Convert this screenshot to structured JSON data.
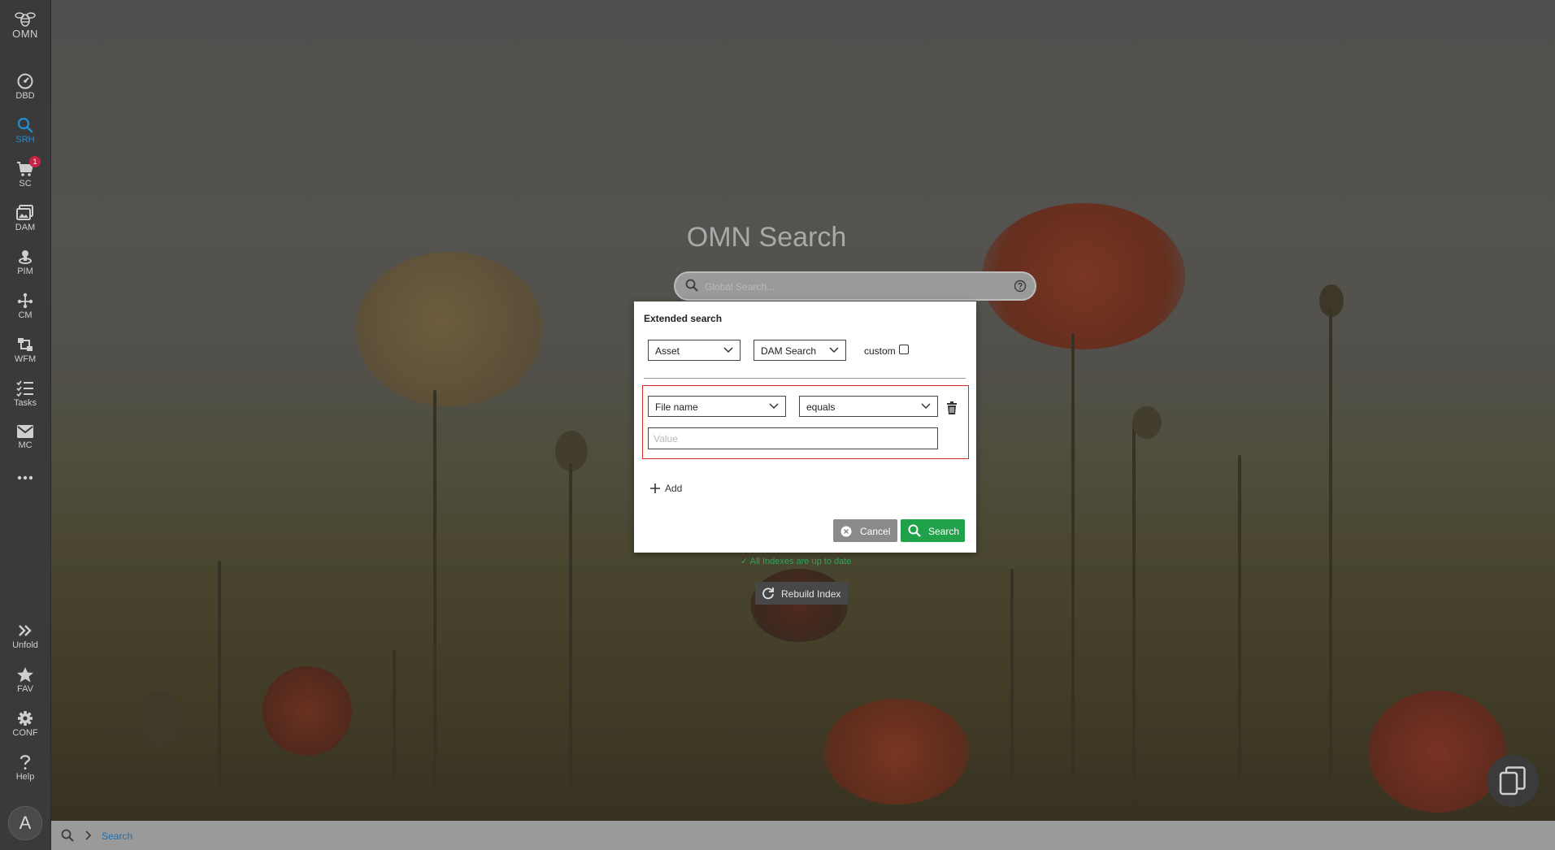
{
  "sidebar": {
    "logo_text": "OMN",
    "items": [
      {
        "label": "DBD",
        "icon": "dashboard-icon"
      },
      {
        "label": "SRH",
        "icon": "search-icon",
        "active": true
      },
      {
        "label": "SC",
        "icon": "cart-icon",
        "badge": "1"
      },
      {
        "label": "DAM",
        "icon": "images-icon"
      },
      {
        "label": "PIM",
        "icon": "product-icon"
      },
      {
        "label": "CM",
        "icon": "hierarchy-icon"
      },
      {
        "label": "WFM",
        "icon": "workflow-icon"
      },
      {
        "label": "Tasks",
        "icon": "tasks-icon"
      },
      {
        "label": "MC",
        "icon": "mail-icon"
      },
      {
        "label": "",
        "icon": "more-icon"
      }
    ],
    "bottom_items": [
      {
        "label": "Unfold",
        "icon": "double-chevron-icon"
      },
      {
        "label": "FAV",
        "icon": "star-icon"
      },
      {
        "label": "CONF",
        "icon": "gear-icon"
      },
      {
        "label": "Help",
        "icon": "question-icon"
      }
    ],
    "avatar_initial": "A"
  },
  "main": {
    "title": "OMN Search",
    "search_placeholder": "Global Search..."
  },
  "dialog": {
    "header": "Extended search",
    "type_select": "Asset",
    "search_select": "DAM Search",
    "custom_label": "custom",
    "custom_checked": false,
    "criteria": [
      {
        "field": "File name",
        "operator": "equals",
        "value": "",
        "value_placeholder": "Value"
      }
    ],
    "add_label": "Add",
    "cancel_label": "Cancel",
    "search_label": "Search"
  },
  "index_status": "✓ All Indexes are up to date",
  "rebuild_label": "Rebuild Index",
  "breadcrumb": {
    "current": "Search"
  },
  "colors": {
    "accent": "#1f8fd6",
    "search_button": "#1fa24a",
    "status_ok": "#2da55a",
    "criteria_border": "#d42a2a",
    "badge": "#c62345"
  }
}
